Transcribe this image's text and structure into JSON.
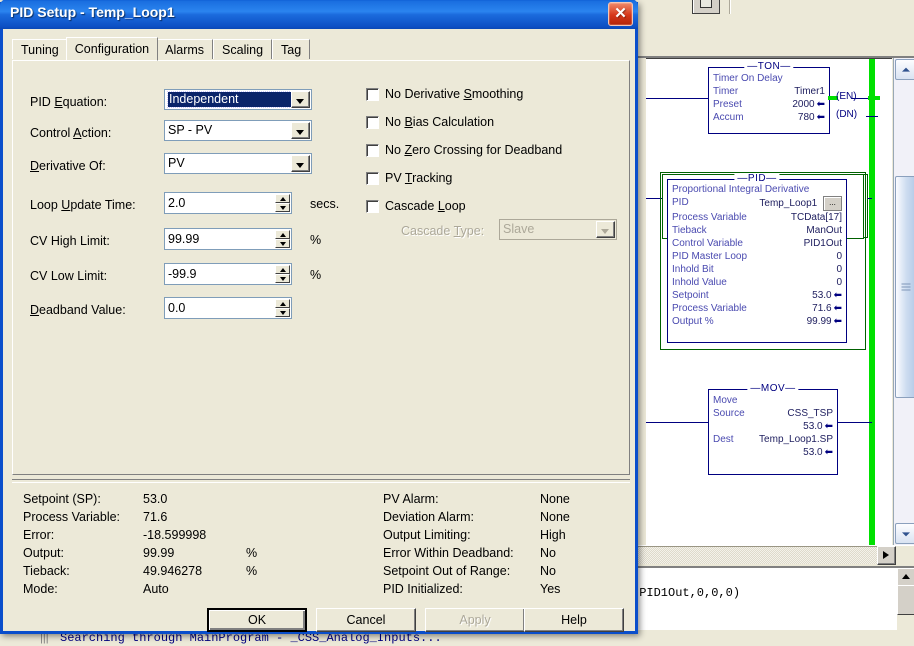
{
  "dialog": {
    "title": "PID Setup - Temp_Loop1",
    "close_icon": "close-icon",
    "tabs": [
      {
        "label": "Tuning",
        "active": false
      },
      {
        "label": "Configuration",
        "active": true
      },
      {
        "label": "Alarms",
        "active": false
      },
      {
        "label": "Scaling",
        "active": false
      },
      {
        "label": "Tag",
        "active": false
      }
    ],
    "fields": [
      {
        "label": "PID Equation:",
        "mnemonic": "E",
        "value": "Independent",
        "type": "combo",
        "selected": true
      },
      {
        "label": "Control Action:",
        "mnemonic": "A",
        "value": "SP - PV",
        "type": "combo",
        "selected": false
      },
      {
        "label": "Derivative Of:",
        "mnemonic": "D",
        "value": "PV",
        "type": "combo",
        "selected": false
      },
      {
        "label": "Loop Update Time:",
        "mnemonic": "U",
        "value": "2.0",
        "type": "spin",
        "unit": "secs."
      },
      {
        "label": "CV High Limit:",
        "mnemonic": "",
        "value": "99.99",
        "type": "spin",
        "unit": "%"
      },
      {
        "label": "CV Low Limit:",
        "mnemonic": "",
        "value": "-99.9",
        "type": "spin",
        "unit": "%"
      },
      {
        "label": "Deadband Value:",
        "mnemonic": "D",
        "value": "0.0",
        "type": "spin",
        "unit": ""
      }
    ],
    "checkboxes": [
      {
        "label": "No Derivative Smoothing",
        "mnemonic": "S",
        "checked": false
      },
      {
        "label": "No Bias Calculation",
        "mnemonic": "B",
        "checked": false
      },
      {
        "label": "No Zero Crossing for Deadband",
        "mnemonic": "Z",
        "checked": false
      },
      {
        "label": "PV Tracking",
        "mnemonic": "T",
        "checked": false
      },
      {
        "label": "Cascade Loop",
        "mnemonic": "L",
        "checked": false
      }
    ],
    "cascade_type": {
      "label": "Cascade Type:",
      "mnemonic": "T",
      "value": "Slave",
      "disabled": true
    },
    "status_left": [
      {
        "label": "Setpoint (SP):",
        "value": "53.0",
        "unit": ""
      },
      {
        "label": "Process Variable:",
        "value": "71.6",
        "unit": ""
      },
      {
        "label": "Error:",
        "value": "-18.599998",
        "unit": ""
      },
      {
        "label": "Output:",
        "value": "99.99",
        "unit": "%"
      },
      {
        "label": "Tieback:",
        "value": "49.946278",
        "unit": "%"
      },
      {
        "label": "Mode:",
        "value": "Auto",
        "unit": ""
      }
    ],
    "status_right": [
      {
        "label": "PV Alarm:",
        "value": "None"
      },
      {
        "label": "Deviation Alarm:",
        "value": "None"
      },
      {
        "label": "Output Limiting:",
        "value": "High"
      },
      {
        "label": "Error Within Deadband:",
        "value": "No"
      },
      {
        "label": "Setpoint Out of Range:",
        "value": "No"
      },
      {
        "label": "PID Initialized:",
        "value": "Yes"
      }
    ],
    "buttons": [
      {
        "label": "OK",
        "default": true,
        "disabled": false
      },
      {
        "label": "Cancel",
        "default": false,
        "disabled": false
      },
      {
        "label": "Apply",
        "default": false,
        "disabled": true,
        "mnemonic": "A"
      },
      {
        "label": "Help",
        "default": false,
        "disabled": false
      }
    ]
  },
  "ladder": {
    "ton": {
      "title": "TON",
      "rows": [
        {
          "label": "Timer On Delay",
          "value": "",
          "arrow": false
        },
        {
          "label": "Timer",
          "value": "Timer1",
          "arrow": false
        },
        {
          "label": "Preset",
          "value": "2000",
          "arrow": true
        },
        {
          "label": "Accum",
          "value": "780",
          "arrow": true
        }
      ],
      "coils": [
        "(EN)",
        "(DN)"
      ]
    },
    "pid": {
      "title": "PID",
      "subtitle": "Proportional Integral Derivative",
      "rows": [
        {
          "label": "PID",
          "value": "Temp_Loop1",
          "arrow": false,
          "browse": "..."
        },
        {
          "label": "Process Variable",
          "value": "TCData[17]",
          "arrow": false
        },
        {
          "label": "Tieback",
          "value": "ManOut",
          "arrow": false
        },
        {
          "label": "Control Variable",
          "value": "PID1Out",
          "arrow": false
        },
        {
          "label": "PID Master Loop",
          "value": "0",
          "arrow": false
        },
        {
          "label": "Inhold Bit",
          "value": "0",
          "arrow": false
        },
        {
          "label": "Inhold Value",
          "value": "0",
          "arrow": false
        },
        {
          "label": "Setpoint",
          "value": "53.0",
          "arrow": true
        },
        {
          "label": "Process Variable",
          "value": "71.6",
          "arrow": true
        },
        {
          "label": "Output %",
          "value": "99.99",
          "arrow": true
        }
      ]
    },
    "mov": {
      "title": "MOV",
      "rows": [
        {
          "label": "Move",
          "value": "",
          "arrow": false
        },
        {
          "label": "Source",
          "value": "CSS_TSP",
          "arrow": false
        },
        {
          "label": "",
          "value": "53.0",
          "arrow": true
        },
        {
          "label": "Dest",
          "value": "Temp_Loop1.SP",
          "arrow": false
        },
        {
          "label": "",
          "value": "53.0",
          "arrow": true
        }
      ]
    }
  },
  "code_pane": {
    "text": ",PID1Out,0,0,0)"
  },
  "bottom_status": {
    "text": "Searching through MainProgram - _CSS_Analog_Inputs..."
  },
  "colors": {
    "title_blue": "#0a4ecb",
    "dialog_face": "#ece9d8",
    "ladder_blue": "#000080",
    "rail_green": "#00e000",
    "close_red": "#d6371a",
    "select_blue": "#0a246a"
  }
}
